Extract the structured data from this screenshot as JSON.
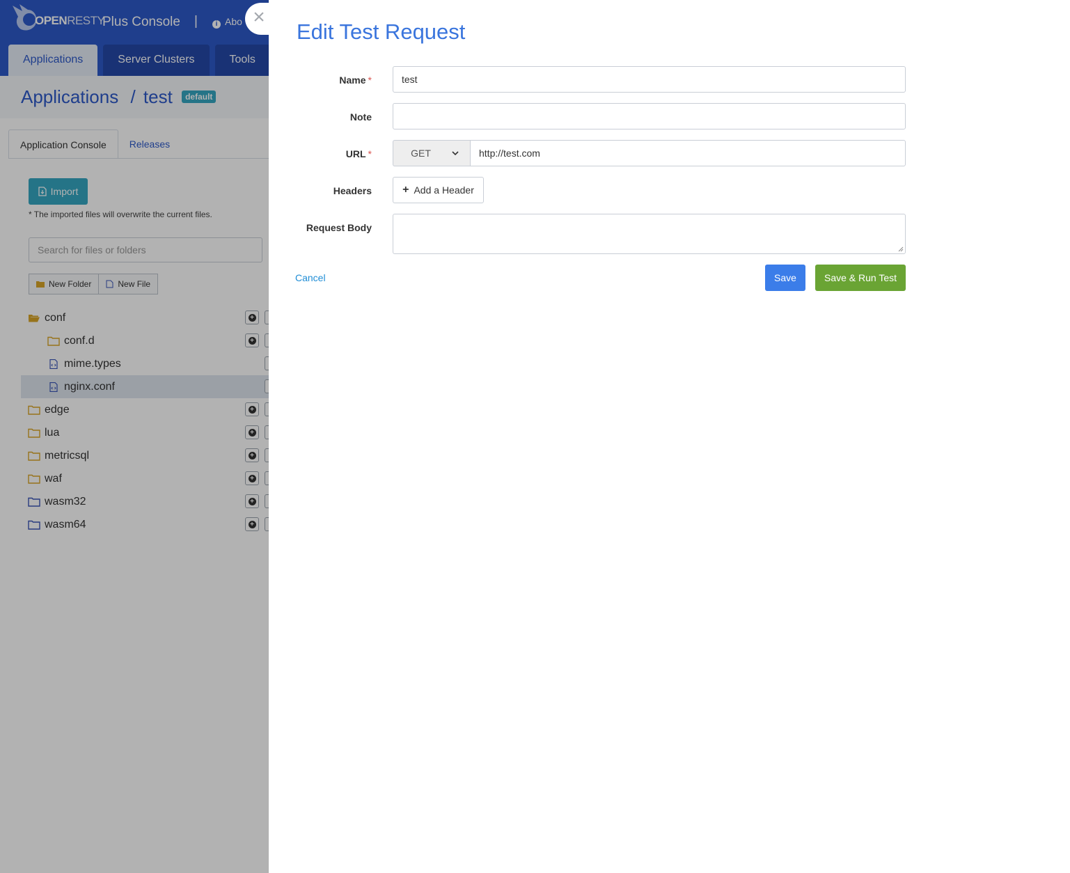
{
  "header": {
    "logo_bold": "OPEN",
    "logo_thin": "RESTY",
    "console_title": "Plus Console",
    "separator": "|",
    "about_label": "Abo"
  },
  "nav": {
    "tabs": [
      {
        "label": "Applications",
        "active": true
      },
      {
        "label": "Server Clusters",
        "active": false
      },
      {
        "label": "Tools",
        "active": false
      }
    ]
  },
  "breadcrumb": {
    "root": "Applications",
    "separator": "/",
    "app": "test",
    "badge": "default"
  },
  "subtabs": [
    {
      "label": "Application Console",
      "active": true
    },
    {
      "label": "Releases",
      "active": false
    }
  ],
  "files": {
    "import_label": "Import",
    "hint": "* The imported files will overwrite the current files.",
    "search_placeholder": "Search for files or folders",
    "new_folder_label": "New Folder",
    "new_file_label": "New File",
    "tree": [
      {
        "label": "conf",
        "type": "folder-open",
        "depth": 0
      },
      {
        "label": "conf.d",
        "type": "folder",
        "depth": 1
      },
      {
        "label": "mime.types",
        "type": "file",
        "depth": 1
      },
      {
        "label": "nginx.conf",
        "type": "file",
        "depth": 1,
        "selected": true
      },
      {
        "label": "edge",
        "type": "folder",
        "depth": 0
      },
      {
        "label": "lua",
        "type": "folder",
        "depth": 0
      },
      {
        "label": "metricsql",
        "type": "folder",
        "depth": 0
      },
      {
        "label": "waf",
        "type": "folder",
        "depth": 0
      },
      {
        "label": "wasm32",
        "type": "folder-blue",
        "depth": 0
      },
      {
        "label": "wasm64",
        "type": "folder-blue",
        "depth": 0
      }
    ]
  },
  "modal": {
    "title": "Edit Test Request",
    "close_icon": "×",
    "fields": {
      "name_label": "Name",
      "name_value": "test",
      "note_label": "Note",
      "note_value": "",
      "url_label": "URL",
      "method_value": "GET",
      "url_value": "http://test.com",
      "headers_label": "Headers",
      "add_header_label": "Add a Header",
      "body_label": "Request Body",
      "required_mark": "*"
    },
    "actions": {
      "cancel": "Cancel",
      "save": "Save",
      "save_run": "Save & Run Test"
    }
  },
  "colors": {
    "brand_blue": "#2d59c9",
    "title_blue": "#3a75dd",
    "save_blue": "#3b7de9",
    "run_green": "#6aa434",
    "teal": "#36a7c2",
    "folder_yellow": "#d9a528",
    "folder_blue": "#3b56b8"
  }
}
